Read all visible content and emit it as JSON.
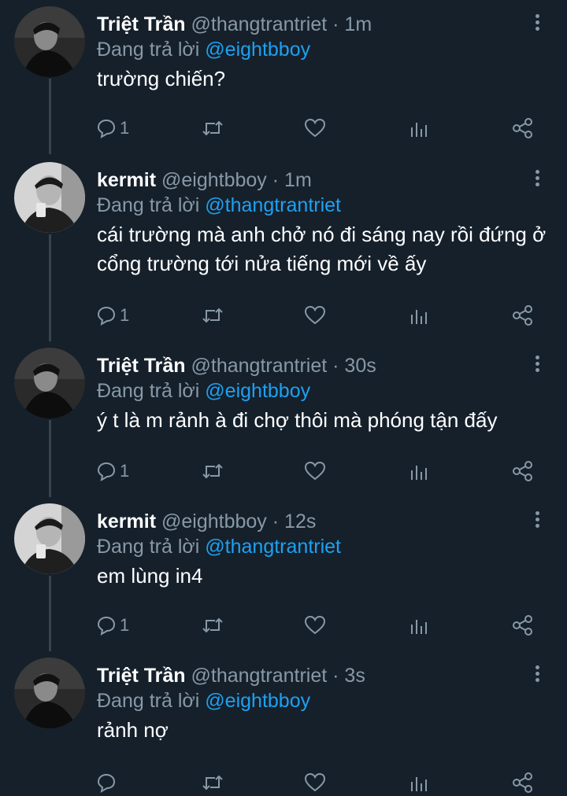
{
  "tweets": [
    {
      "author": "Triệt Trần",
      "handle": "@thangtrantriet",
      "time": "· 1m",
      "reply_prefix": "Đang trả lời",
      "reply_to": "@eightbboy",
      "text": "trường chiến?",
      "reply_count": "1",
      "avatar": "avatar-triet"
    },
    {
      "author": "kermit",
      "handle": "@eightbboy",
      "time": "· 1m",
      "reply_prefix": "Đang trả lời",
      "reply_to": "@thangtrantriet",
      "text": "cái trường mà anh chở nó đi sáng nay rồi đứng ở cổng trường tới nửa tiếng mới về ấy",
      "reply_count": "1",
      "avatar": "avatar-kermit"
    },
    {
      "author": "Triệt Trần",
      "handle": "@thangtrantriet",
      "time": "· 30s",
      "reply_prefix": "Đang trả lời",
      "reply_to": "@eightbboy",
      "text": "ý t là m rảnh à đi chợ thôi mà phóng tận đấy",
      "reply_count": "1",
      "avatar": "avatar-triet"
    },
    {
      "author": "kermit",
      "handle": "@eightbboy",
      "time": "· 12s",
      "reply_prefix": "Đang trả lời",
      "reply_to": "@thangtrantriet",
      "text": "em lùng in4",
      "reply_count": "1",
      "avatar": "avatar-kermit"
    },
    {
      "author": "Triệt Trần",
      "handle": "@thangtrantriet",
      "time": "· 3s",
      "reply_prefix": "Đang trả lời",
      "reply_to": "@eightbboy",
      "text": "rảnh nợ",
      "reply_count": "",
      "avatar": "avatar-triet"
    }
  ],
  "icons": {
    "reply": "reply-icon",
    "retweet": "retweet-icon",
    "like": "heart-icon",
    "analytics": "analytics-icon",
    "share": "share-icon",
    "more": "more-vertical-icon"
  },
  "colors": {
    "background": "#15202b",
    "text": "#ffffff",
    "muted": "#8899a6",
    "link": "#1da1f2",
    "thread_line": "#38444d"
  }
}
